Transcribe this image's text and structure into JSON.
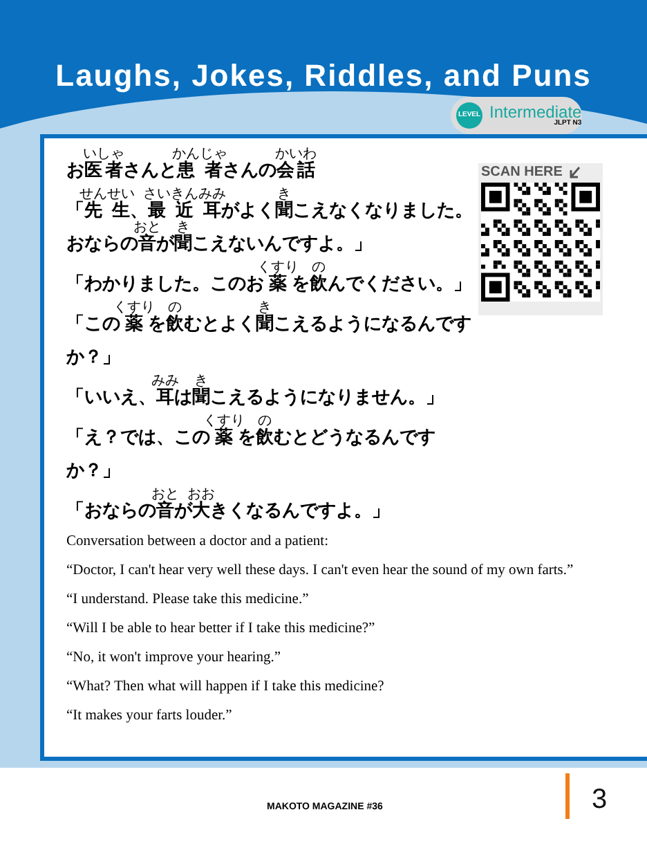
{
  "title": "Laughs, Jokes, Riddles, and Puns",
  "level_badge": {
    "tag": "LEVEL",
    "level": "Intermediate",
    "exam": "JLPT N3"
  },
  "qr": {
    "label": "SCAN HERE"
  },
  "japanese_lines": [
    [
      {
        "t": "お"
      },
      {
        "t": "医者",
        "r": "いしゃ"
      },
      {
        "t": "さんと"
      },
      {
        "t": "患者",
        "r": "かんじゃ"
      },
      {
        "t": "さんの"
      },
      {
        "t": "会話",
        "r": "かいわ"
      }
    ],
    [
      {
        "t": "「"
      },
      {
        "t": "先生",
        "r": "せんせい"
      },
      {
        "t": "、"
      },
      {
        "t": "最近",
        "r": "さいきん"
      },
      {
        "t": "耳",
        "r": "みみ"
      },
      {
        "t": "がよく"
      },
      {
        "t": "聞",
        "r": "き"
      },
      {
        "t": "こえなくなりました。おならの"
      },
      {
        "t": "音",
        "r": "おと"
      },
      {
        "t": "が"
      },
      {
        "t": "聞",
        "r": "き"
      },
      {
        "t": "こえないんですよ。」"
      }
    ],
    [
      {
        "t": "「わかりました。このお"
      },
      {
        "t": "薬",
        "r": "くすり"
      },
      {
        "t": "を"
      },
      {
        "t": "飲",
        "r": "の"
      },
      {
        "t": "んでください。」"
      }
    ],
    [
      {
        "t": "「この"
      },
      {
        "t": "薬",
        "r": "くすり"
      },
      {
        "t": "を"
      },
      {
        "t": "飲",
        "r": "の"
      },
      {
        "t": "むとよく"
      },
      {
        "t": "聞",
        "r": "き"
      },
      {
        "t": "こえるようになるんですか？」"
      }
    ],
    [
      {
        "t": "「いいえ、"
      },
      {
        "t": "耳",
        "r": "みみ"
      },
      {
        "t": "は"
      },
      {
        "t": "聞",
        "r": "き"
      },
      {
        "t": "こえるようになりません。」"
      }
    ],
    [
      {
        "t": "「え？では、この"
      },
      {
        "t": "薬",
        "r": "くすり"
      },
      {
        "t": "を"
      },
      {
        "t": "飲",
        "r": "の"
      },
      {
        "t": "むとどうなるんですか？」"
      }
    ],
    [
      {
        "t": "「おならの"
      },
      {
        "t": "音",
        "r": "おと"
      },
      {
        "t": "が"
      },
      {
        "t": "大",
        "r": "おお"
      },
      {
        "t": "きくなるんですよ。」"
      }
    ]
  ],
  "english_lines": [
    "Conversation between a doctor and a patient:",
    "“Doctor, I can't hear very well these days. I can't even hear the sound of my own farts.”",
    "“I understand. Please take this medicine.”",
    "“Will I be able to hear better if I take this medicine?”",
    "“No, it won't improve your hearing.”",
    "“What? Then what will happen if I take this medicine?",
    "“It makes your farts louder.”"
  ],
  "footer": {
    "magazine": "MAKOTO MAGAZINE #36",
    "page": "3"
  }
}
